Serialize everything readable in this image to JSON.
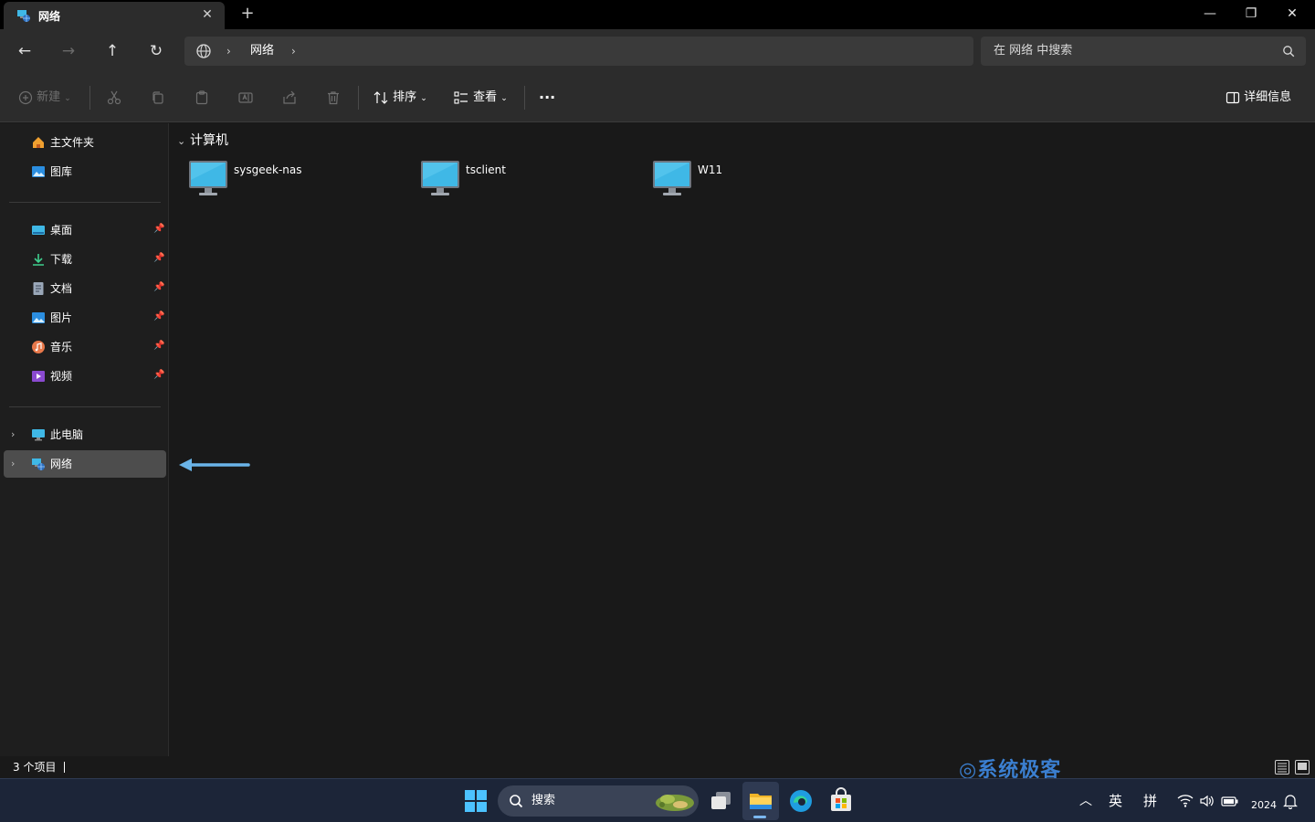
{
  "window": {
    "tab_title": "网络",
    "tab_close": "✕",
    "new_tab": "+",
    "minimize": "—",
    "maximize": "❐",
    "close": "✕"
  },
  "address_bar": {
    "back": "←",
    "forward": "→",
    "up": "↑",
    "refresh": "↻",
    "crumb_separator": "›",
    "breadcrumb": "网络",
    "search_placeholder": "在 网络 中搜索"
  },
  "command_bar": {
    "new_label": "新建",
    "sort_label": "排序",
    "view_label": "查看",
    "more_label": "···",
    "details_label": "详细信息"
  },
  "sidebar": {
    "quick": [
      {
        "label": "主文件夹",
        "icon": "home-icon"
      },
      {
        "label": "图库",
        "icon": "gallery-icon"
      }
    ],
    "pinned": [
      {
        "label": "桌面",
        "icon": "desktop-icon"
      },
      {
        "label": "下载",
        "icon": "download-icon"
      },
      {
        "label": "文档",
        "icon": "documents-icon"
      },
      {
        "label": "图片",
        "icon": "pictures-icon"
      },
      {
        "label": "音乐",
        "icon": "music-icon"
      },
      {
        "label": "视频",
        "icon": "videos-icon"
      }
    ],
    "locations": [
      {
        "label": "此电脑",
        "icon": "this-pc-icon",
        "selected": false
      },
      {
        "label": "网络",
        "icon": "network-icon",
        "selected": true
      }
    ]
  },
  "content": {
    "group_title": "计算机",
    "items": [
      {
        "name": "sysgeek-nas",
        "icon": "computer-icon"
      },
      {
        "name": "tsclient",
        "icon": "computer-icon"
      },
      {
        "name": "W11",
        "icon": "computer-icon"
      }
    ]
  },
  "status_bar": {
    "item_count": "3 个项目"
  },
  "watermark": "◎系统极客",
  "taskbar": {
    "search_label": "搜索",
    "ime_lang": "英",
    "ime_mode": "拼",
    "clock": "2024"
  },
  "colors": {
    "accent": "#4cc2ff",
    "monitor_screen": "#3fb8e6",
    "taskbar_bg": "#1c2538",
    "watermark": "#3b7fd0",
    "arrow": "#6ab4e8"
  }
}
